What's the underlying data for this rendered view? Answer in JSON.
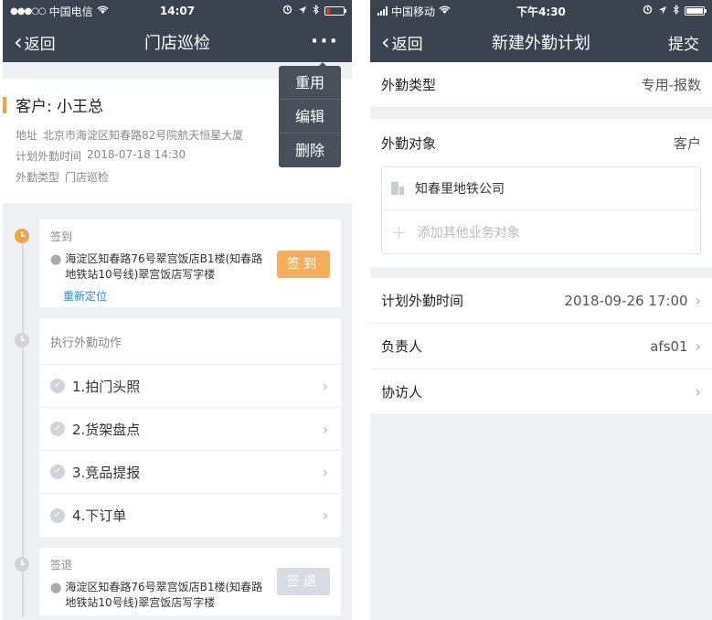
{
  "left": {
    "status": {
      "carrier": "中国电信",
      "time": "14:07"
    },
    "nav": {
      "back": "返回",
      "title": "门店巡检"
    },
    "menu": [
      "重用",
      "编辑",
      "删除"
    ],
    "customer": {
      "name": "客户: 小王总",
      "address_label": "地址",
      "address": "北京市海淀区知春路82号院航天恒星大厦",
      "plan_time_label": "计划外勤时间",
      "plan_time": "2018-07-18 14:30",
      "type_label": "外勤类型",
      "type": "门店巡检"
    },
    "checkin": {
      "title": "签到",
      "address": "海淀区知春路76号翠宫饭店B1楼(知春路地铁站10号线)翠宫饭店写字楼",
      "relocate": "重新定位",
      "button": "签到"
    },
    "actions": {
      "title": "执行外勤动作",
      "items": [
        "1.拍门头照",
        "2.货架盘点",
        "3.竞品提报",
        "4.下订单"
      ]
    },
    "checkout": {
      "title": "签退",
      "address": "海淀区知春路76号翠宫饭店B1楼(知春路地铁站10号线)翠宫饭店写字楼",
      "button": "签退"
    }
  },
  "right": {
    "status": {
      "carrier": "中国移动",
      "time": "下午4:30"
    },
    "nav": {
      "back": "返回",
      "title": "新建外勤计划",
      "submit": "提交"
    },
    "field_type": {
      "label": "外勤类型",
      "value": "专用-报数"
    },
    "field_target": {
      "label": "外勤对象",
      "value": "客户"
    },
    "target_company": "知春里地铁公司",
    "add_target": "添加其他业务对象",
    "field_time": {
      "label": "计划外勤时间",
      "value": "2018-09-26 17:00"
    },
    "field_owner": {
      "label": "负责人",
      "value": "afs01"
    },
    "field_visitor": {
      "label": "协访人",
      "value": ""
    }
  },
  "colors": {
    "navbar": "#3b4250",
    "accent_orange": "#f5a342",
    "link_blue": "#2d89e6"
  },
  "icons": [
    "wifi-icon",
    "location-arrow-icon",
    "alarm-icon",
    "bluetooth-icon",
    "battery-icon",
    "more-icon",
    "chevron-left-icon",
    "chevron-right-icon",
    "clock-icon",
    "pin-icon",
    "check-circle-icon",
    "building-icon",
    "plus-icon"
  ]
}
